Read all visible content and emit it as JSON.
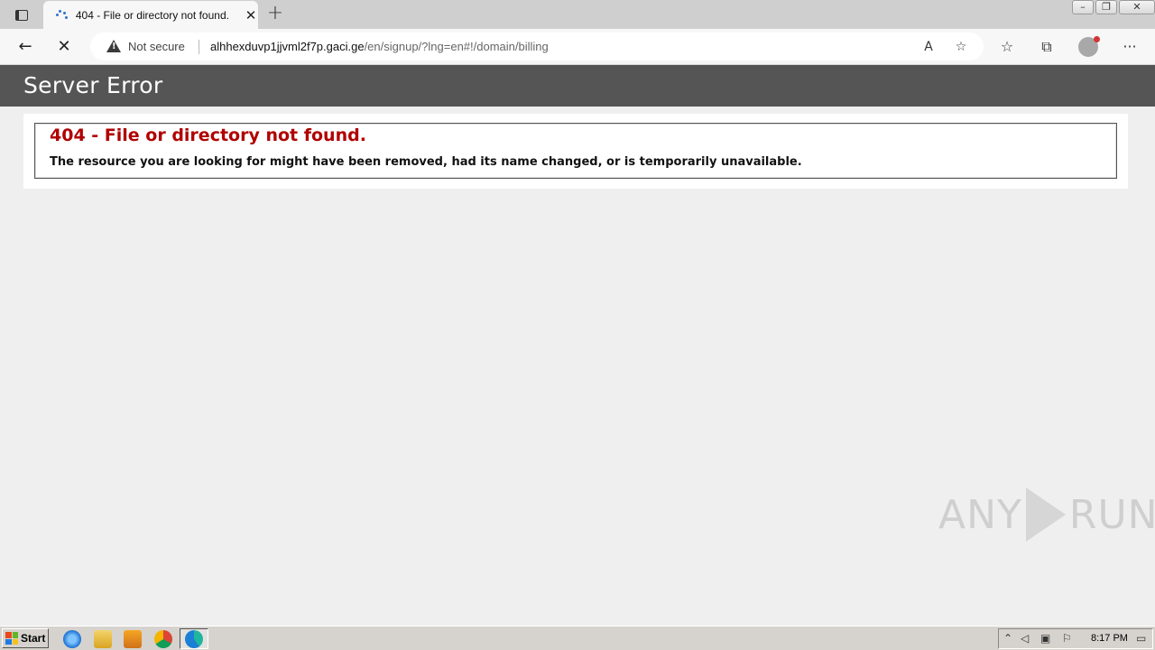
{
  "browser": {
    "tab_title": "404 - File or directory not found.",
    "tab_close": "✕",
    "new_tab": "+",
    "security_label": "Not secure",
    "url_host": "alhhexduvp1jjvml2f7p.gaci.ge",
    "url_path": "/en/signup/?lng=en#!/domain/billing",
    "back": "←",
    "stop": "✕",
    "more": "···"
  },
  "page": {
    "header_title": "Server Error",
    "error_title": "404 - File or directory not found.",
    "error_message": "The resource you are looking for might have been removed, had its name changed, or is temporarily unavailable."
  },
  "watermark": {
    "left": "ANY",
    "right": "RUN"
  },
  "taskbar": {
    "start_label": "Start",
    "clock": "8:17 PM"
  },
  "colors": {
    "header_bg": "#555555",
    "error_red": "#b00000"
  }
}
